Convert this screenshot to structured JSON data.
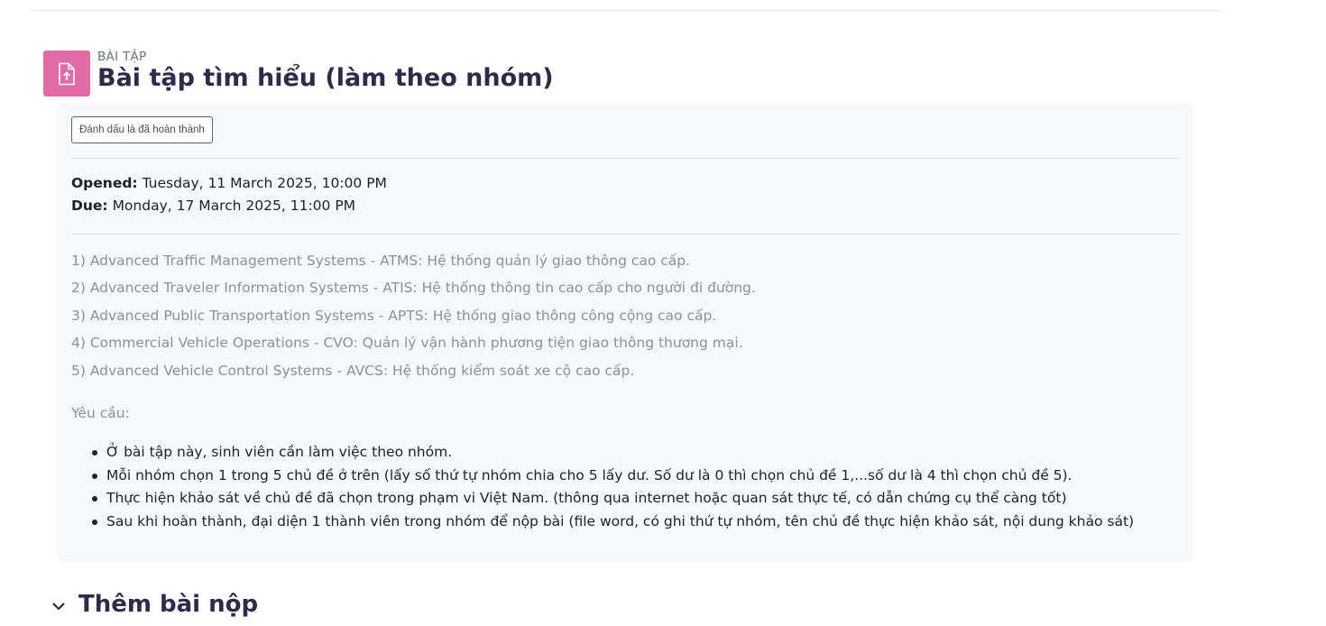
{
  "header": {
    "activity_type": "BÀI TẬP",
    "title": "Bài tập tìm hiểu (làm theo nhóm)",
    "icon": "assignment-upload-icon",
    "icon_color": "#e26ba6"
  },
  "completion": {
    "button_label": "Đánh dấu là đã hoàn thành"
  },
  "dates": {
    "opened_label": "Opened:",
    "opened_value": "Tuesday, 11 March 2025, 10:00 PM",
    "due_label": "Due:",
    "due_value": "Monday, 17 March 2025, 11:00 PM"
  },
  "topics": [
    "1) Advanced Traffic Management Systems - ATMS: Hệ thống quản lý giao thông cao cấp.",
    "2) Advanced Traveler Information Systems - ATIS: Hệ thống thông tin cao cấp cho người đi đường.",
    "3) Advanced Public Transportation Systems - APTS: Hệ thống giao thông công cộng cao cấp.",
    "4) Commercial Vehicle Operations - CVO: Quản lý vận hành phương tiện giao thông thương mại.",
    "5) Advanced Vehicle Control Systems - AVCS: Hệ thống kiểm soát xe cộ cao cấp."
  ],
  "requirements": {
    "label": "Yêu cầu:",
    "items": [
      "Ở bài tập này, sinh viên cần làm việc theo nhóm.",
      "Mỗi nhóm chọn 1 trong 5 chủ đề ở trên (lấy số thứ tự nhóm chia cho 5 lấy dư. Số dư là 0 thì chọn chủ đề 1,...số dư là 4 thì chọn chủ đề 5).",
      "Thực hiện khảo sát về chủ đề đã chọn trong phạm vi Việt Nam. (thông qua internet hoặc quan sát thực tế, có dẫn chứng cụ thể càng tốt)",
      "Sau khi hoàn thành, đại diện 1 thành viên trong nhóm để nộp bài (file word, có ghi thứ tự nhóm, tên chủ đề thực hiện khảo sát, nội dung khảo sát)"
    ]
  },
  "submission_section": {
    "title": "Thêm bài nộp",
    "toggle_icon": "chevron-down-icon"
  }
}
